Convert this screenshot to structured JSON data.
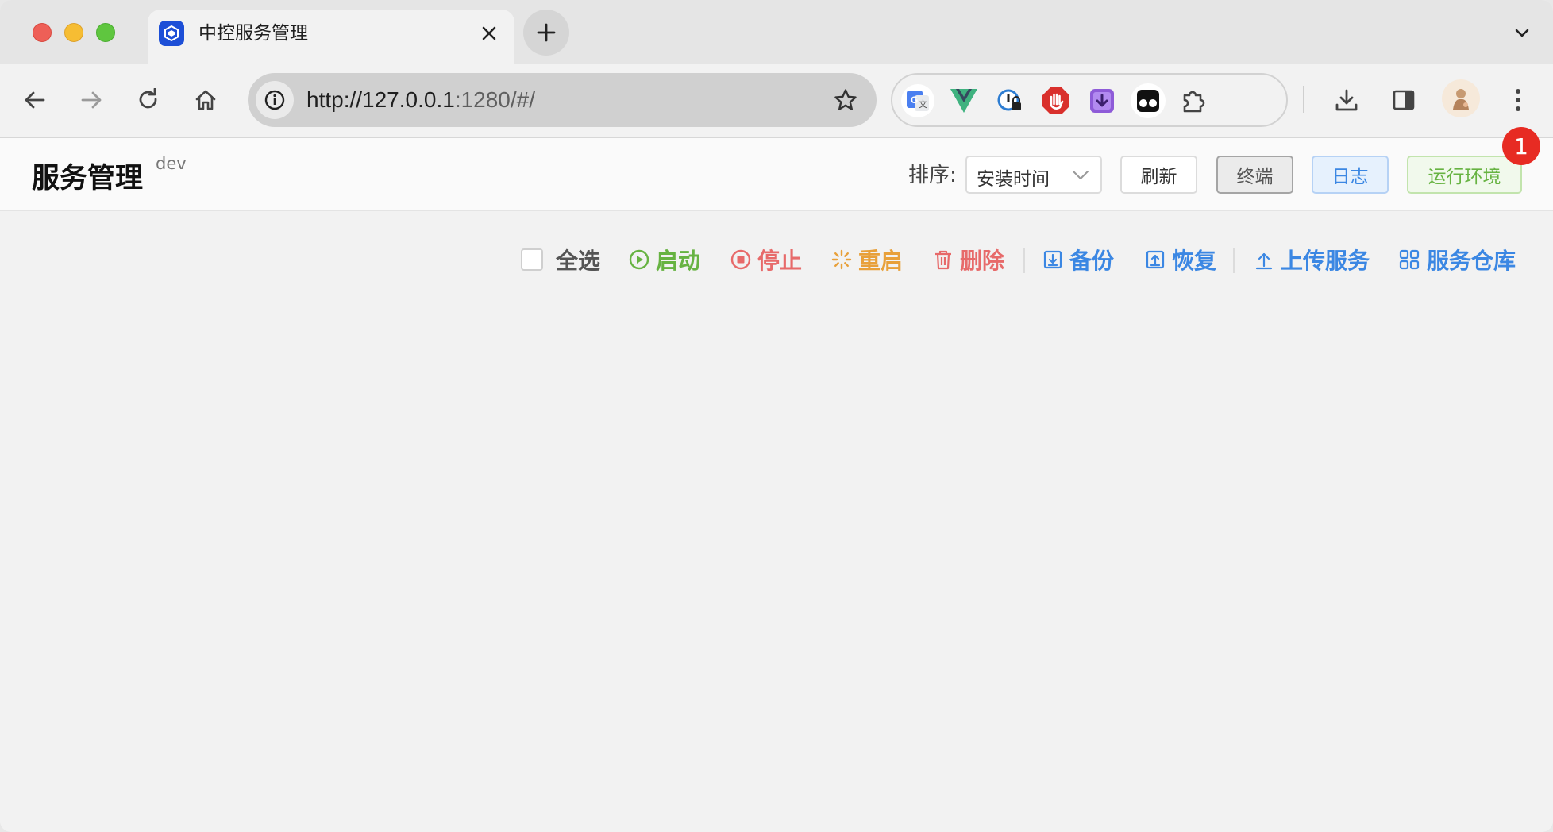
{
  "browser": {
    "tab_title": "中控服务管理",
    "url_host": "http://127.0.0.1",
    "url_rest": ":1280/#/",
    "icons": {
      "back": "back-arrow-icon",
      "forward": "forward-arrow-icon",
      "reload": "reload-icon",
      "home": "home-icon",
      "info": "info-icon",
      "bookmark": "star-icon",
      "extensions": [
        "google-translate-icon",
        "vue-devtools-icon",
        "password-manager-icon",
        "adblock-icon",
        "download-manager-icon",
        "tampermonkey-icon",
        "puzzle-extensions-icon"
      ],
      "download": "download-icon",
      "sidepanel": "side-panel-icon",
      "menu": "kebab-menu-icon"
    }
  },
  "header": {
    "title": "服务管理",
    "env": "dev",
    "sort_label": "排序:",
    "sort_value": "安装时间",
    "refresh_label": "刷新",
    "terminal_label": "终端",
    "logs_label": "日志",
    "runtime_label": "运行环境",
    "badge_count": "1"
  },
  "actions": {
    "select_all": "全选",
    "start": "启动",
    "stop": "停止",
    "restart": "重启",
    "delete": "删除",
    "backup": "备份",
    "restore": "恢复",
    "upload": "上传服务",
    "repository": "服务仓库"
  },
  "colors": {
    "green": "#67b342",
    "red": "#e76a6a",
    "orange": "#e8a03a",
    "blue": "#3b87e3",
    "badge": "#e72b23"
  }
}
